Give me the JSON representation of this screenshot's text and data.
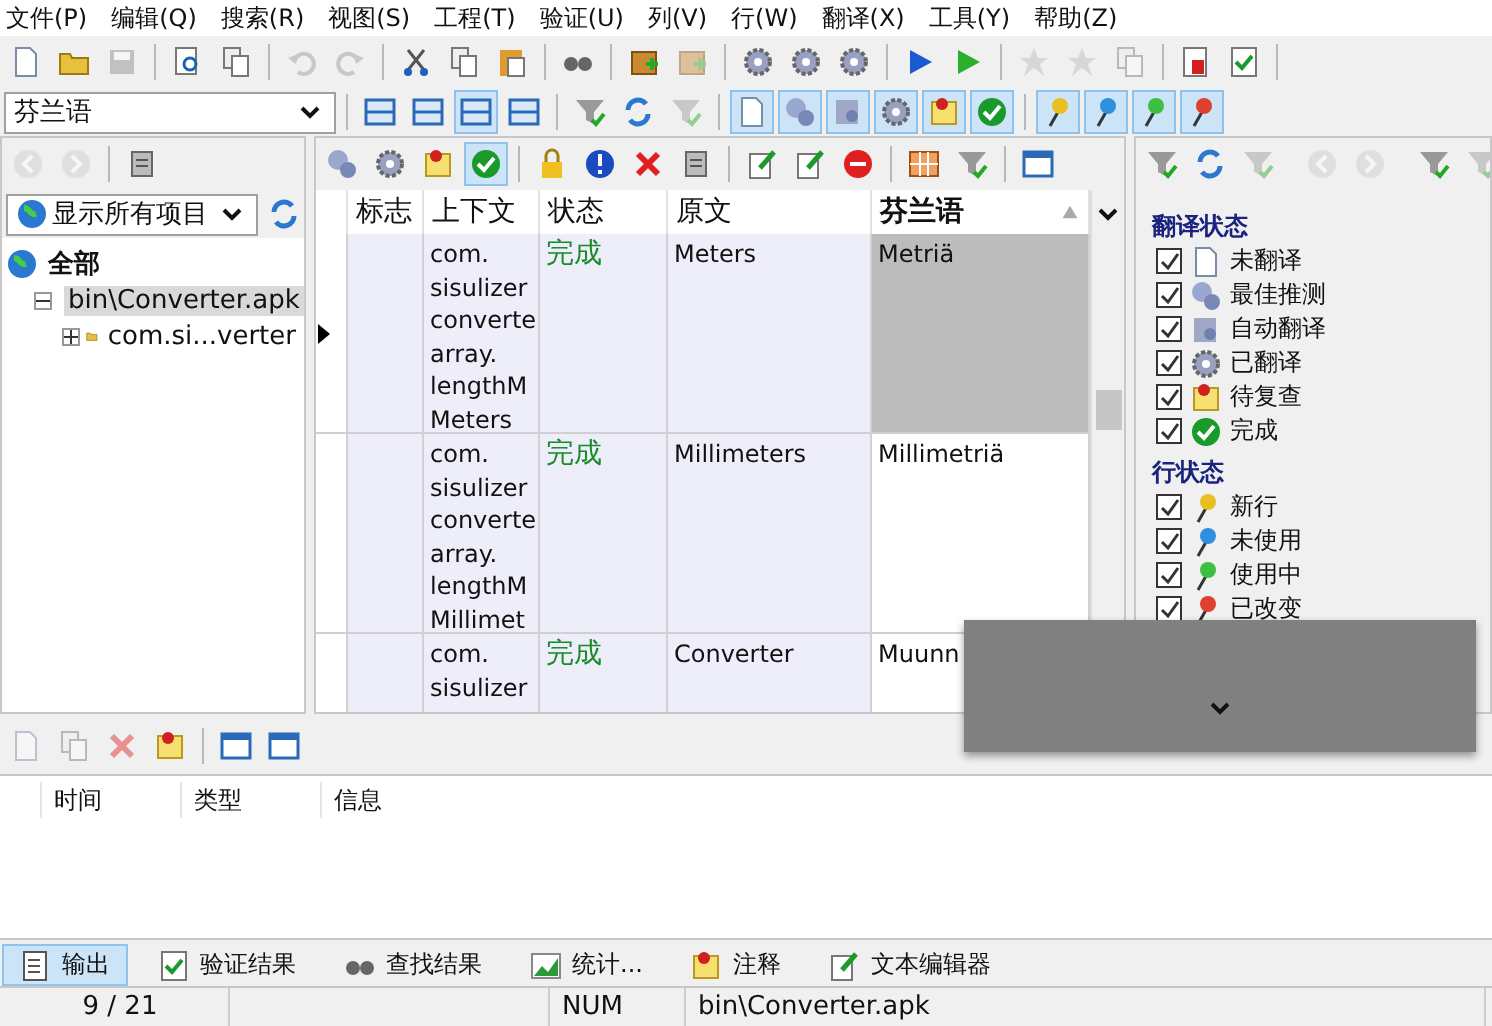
{
  "menu": [
    "文件(P)",
    "编辑(Q)",
    "搜索(R)",
    "视图(S)",
    "工程(T)",
    "验证(U)",
    "列(V)",
    "行(W)",
    "翻译(X)",
    "工具(Y)",
    "帮助(Z)"
  ],
  "language_select": {
    "value": "芬兰语"
  },
  "layout_buttons": [
    {
      "on": false
    },
    {
      "on": false
    },
    {
      "on": true
    },
    {
      "on": false
    }
  ],
  "status_filter_buttons": [
    {
      "on": true
    },
    {
      "on": true
    },
    {
      "on": true
    },
    {
      "on": true
    },
    {
      "on": true
    },
    {
      "on": true
    }
  ],
  "row_filter_buttons": [
    {
      "on": true
    },
    {
      "on": true
    },
    {
      "on": true
    },
    {
      "on": true
    }
  ],
  "project_filter": {
    "value": "显示所有项目"
  },
  "tree": [
    {
      "label": "全部",
      "selected": false,
      "children": [
        {
          "label": "bin\\Converter.apk",
          "expanded": true,
          "selected": true,
          "children": [
            {
              "label": "com.si...verter",
              "expanded": false,
              "selected": false
            }
          ]
        }
      ]
    }
  ],
  "table": {
    "columns": [
      "标志",
      "上下文",
      "状态",
      "原文",
      "芬兰语"
    ],
    "rows": [
      {
        "selected": true,
        "context": "com.\nsisulizer\nconverte\narray.\nlengthM\nMeters",
        "status": "完成",
        "source": "Meters",
        "translation": "Metriä"
      },
      {
        "selected": false,
        "context": "com.\nsisulizer\nconverte\narray.\nlengthM\nMillimet",
        "status": "完成",
        "source": "Millimeters",
        "translation": "Millimetriä"
      },
      {
        "selected": false,
        "context": "com.\nsisulizer",
        "status": "完成",
        "source": "Converter",
        "translation": "Muunn"
      }
    ]
  },
  "filters": [
    {
      "title": "翻译状态",
      "items": [
        {
          "label": "未翻译",
          "checked": true
        },
        {
          "label": "最佳推测",
          "checked": true
        },
        {
          "label": "自动翻译",
          "checked": true
        },
        {
          "label": "已翻译",
          "checked": true
        },
        {
          "label": "待复查",
          "checked": true
        },
        {
          "label": "完成",
          "checked": true
        }
      ]
    },
    {
      "title": "行状态",
      "items": [
        {
          "label": "新行",
          "checked": true,
          "color": "#e8c020"
        },
        {
          "label": "未使用",
          "checked": true,
          "color": "#2f8fe0"
        },
        {
          "label": "使用中",
          "checked": true,
          "color": "#3cc040"
        },
        {
          "label": "已改变",
          "checked": true,
          "color": "#e04030"
        }
      ]
    }
  ],
  "log": {
    "columns": [
      "时间",
      "类型",
      "信息"
    ]
  },
  "bottom_tabs": [
    {
      "label": "输出",
      "selected": true
    },
    {
      "label": "验证结果",
      "selected": false
    },
    {
      "label": "查找结果",
      "selected": false
    },
    {
      "label": "统计...",
      "selected": false
    },
    {
      "label": "注释",
      "selected": false
    },
    {
      "label": "文本编辑器",
      "selected": false
    }
  ],
  "status_bar": [
    "9 / 21",
    "NUM",
    "bin\\Converter.apk"
  ]
}
